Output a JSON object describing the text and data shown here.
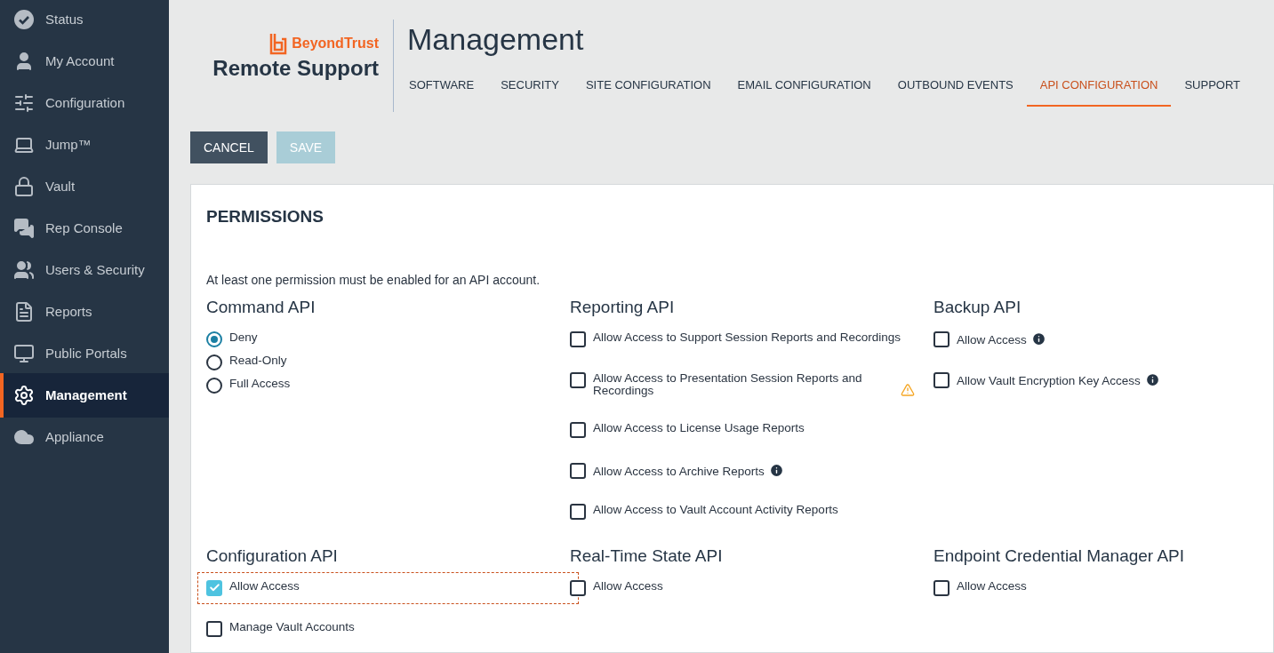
{
  "sidebar": {
    "items": [
      {
        "label": "Status",
        "selected": false
      },
      {
        "label": "My Account",
        "selected": false
      },
      {
        "label": "Configuration",
        "selected": false
      },
      {
        "label": "Jump™",
        "selected": false
      },
      {
        "label": "Vault",
        "selected": false
      },
      {
        "label": "Rep Console",
        "selected": false
      },
      {
        "label": "Users & Security",
        "selected": false
      },
      {
        "label": "Reports",
        "selected": false
      },
      {
        "label": "Public Portals",
        "selected": false
      },
      {
        "label": "Management",
        "selected": true
      },
      {
        "label": "Appliance",
        "selected": false
      }
    ]
  },
  "header": {
    "brand": "BeyondTrust",
    "product": "Remote Support",
    "title": "Management"
  },
  "tabs": [
    {
      "label": "SOFTWARE",
      "selected": false
    },
    {
      "label": "SECURITY",
      "selected": false
    },
    {
      "label": "SITE CONFIGURATION",
      "selected": false
    },
    {
      "label": "EMAIL CONFIGURATION",
      "selected": false
    },
    {
      "label": "OUTBOUND EVENTS",
      "selected": false
    },
    {
      "label": "API CONFIGURATION",
      "selected": true
    },
    {
      "label": "SUPPORT",
      "selected": false
    }
  ],
  "buttons": [
    {
      "label": "CANCEL",
      "disabled": false
    },
    {
      "label": "SAVE",
      "disabled": true
    }
  ],
  "panel": {
    "title": "PERMISSIONS",
    "note": "At least one permission must be enabled for an API account.",
    "groups": [
      {
        "title": "Command API",
        "options": [
          {
            "kind": "radio",
            "label": "Deny",
            "selected": true
          },
          {
            "kind": "radio",
            "label": "Read-Only",
            "selected": false
          },
          {
            "kind": "radio",
            "label": "Full Access",
            "selected": false
          }
        ]
      },
      {
        "title": "Reporting API",
        "options": [
          {
            "kind": "checkbox",
            "label": "Allow Access to Support Session Reports and Recordings",
            "checked": false
          },
          {
            "kind": "checkbox",
            "label": "Allow Access to Presentation Session Reports and Recordings",
            "checked": false,
            "warning": true
          },
          {
            "kind": "checkbox",
            "label": "Allow Access to License Usage Reports",
            "checked": false
          },
          {
            "kind": "checkbox",
            "label": "Allow Access to Archive Reports",
            "checked": false,
            "info": true
          },
          {
            "kind": "checkbox",
            "label": "Allow Access to Vault Account Activity Reports",
            "checked": false
          }
        ]
      },
      {
        "title": "Backup API",
        "options": [
          {
            "kind": "checkbox",
            "label": "Allow Access",
            "checked": false,
            "info": true
          },
          {
            "kind": "checkbox",
            "label": "Allow Vault Encryption Key Access",
            "checked": false,
            "info": true
          }
        ]
      },
      {
        "title": "Configuration API",
        "options": [
          {
            "kind": "checkbox",
            "label": "Allow Access",
            "checked": true,
            "focused": true
          },
          {
            "kind": "checkbox",
            "label": "Manage Vault Accounts",
            "checked": false
          }
        ]
      },
      {
        "title": "Real-Time State API",
        "options": [
          {
            "kind": "checkbox",
            "label": "Allow Access",
            "checked": false
          }
        ]
      },
      {
        "title": "Endpoint Credential Manager API",
        "options": [
          {
            "kind": "checkbox",
            "label": "Allow Access",
            "checked": false
          }
        ]
      }
    ]
  }
}
